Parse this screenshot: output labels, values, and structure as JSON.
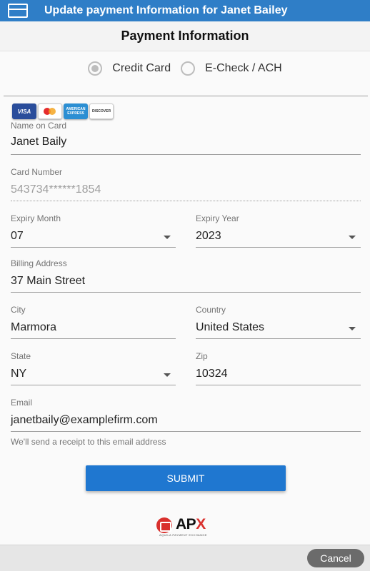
{
  "titlebar": {
    "title": "Update payment Information for Janet Bailey"
  },
  "header": {
    "title": "Payment Information"
  },
  "payment_type": {
    "options": [
      {
        "label": "Credit Card",
        "selected": true
      },
      {
        "label": "E-Check / ACH",
        "selected": false
      }
    ]
  },
  "card_logos": {
    "visa": "VISA",
    "amex": "AMERICAN EXPRESS",
    "discover": "DISCOVER"
  },
  "form": {
    "name_on_card": {
      "label": "Name on Card",
      "value": "Janet Baily"
    },
    "card_number": {
      "label": "Card Number",
      "value": "543734******1854"
    },
    "expiry_month": {
      "label": "Expiry Month",
      "value": "07"
    },
    "expiry_year": {
      "label": "Expiry Year",
      "value": "2023"
    },
    "billing_address": {
      "label": "Billing Address",
      "value": "37 Main Street"
    },
    "city": {
      "label": "City",
      "value": "Marmora"
    },
    "country": {
      "label": "Country",
      "value": "United States"
    },
    "state": {
      "label": "State",
      "value": "NY"
    },
    "zip": {
      "label": "Zip",
      "value": "10324"
    },
    "email": {
      "label": "Email",
      "value": "janetbaily@examplefirm.com",
      "hint": "We'll send a receipt to this email address"
    }
  },
  "submit_label": "SUBMIT",
  "logo": {
    "name_a": "AP",
    "name_b": "X",
    "tagline": "AQUILA PAYMENT EXCHANGE"
  },
  "footer": {
    "cancel_label": "Cancel"
  },
  "colors": {
    "titlebar": "#2f7ec7",
    "submit": "#1f77d0",
    "brand_red": "#d9302d",
    "cancel": "#6b6b6b"
  }
}
